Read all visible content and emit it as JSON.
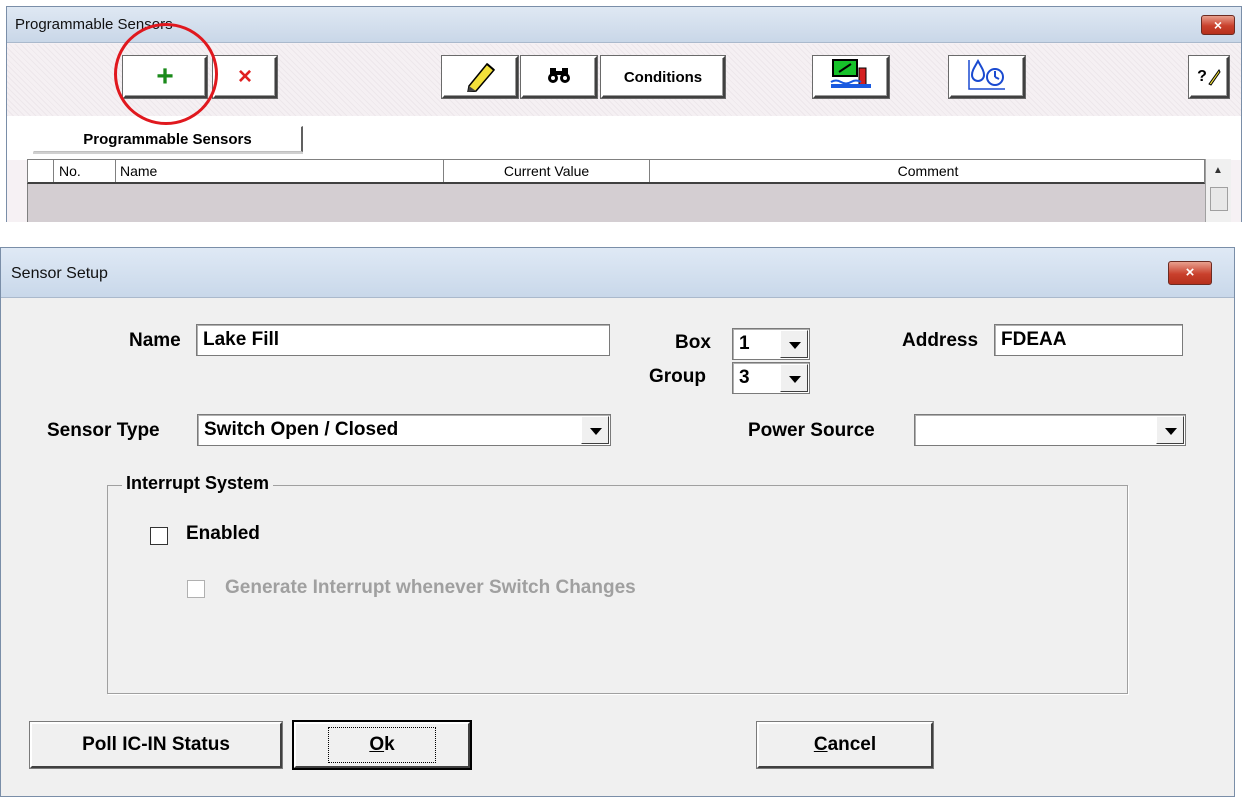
{
  "programmable_sensors_window": {
    "title": "Programmable Sensors",
    "close_label": "×",
    "toolbar": {
      "add_label": "+",
      "delete_label": "×",
      "conditions_label": "Conditions",
      "help_label": "?"
    },
    "tab_label": "Programmable Sensors",
    "columns": [
      "No.",
      "Name",
      "Current Value",
      "Comment"
    ]
  },
  "sensor_setup_dialog": {
    "title": "Sensor Setup",
    "close_label": "×",
    "name_label": "Name",
    "name_value": "Lake Fill",
    "box_label": "Box",
    "box_value": "1",
    "group_label": "Group",
    "group_value": "3",
    "address_label": "Address",
    "address_value": "FDEAA",
    "sensor_type_label": "Sensor Type",
    "sensor_type_value": "Switch Open / Closed",
    "power_source_label": "Power Source",
    "power_source_value": "",
    "interrupt_group_label": "Interrupt System",
    "enabled_label": "Enabled",
    "enabled_checked": false,
    "generate_interrupt_label": "Generate Interrupt whenever Switch Changes",
    "generate_interrupt_checked": false,
    "poll_button_label": "Poll IC-IN Status",
    "ok_button_label_underlined": "O",
    "ok_button_label_rest": "k",
    "cancel_button_label_underlined": "C",
    "cancel_button_label_rest": "ancel"
  }
}
